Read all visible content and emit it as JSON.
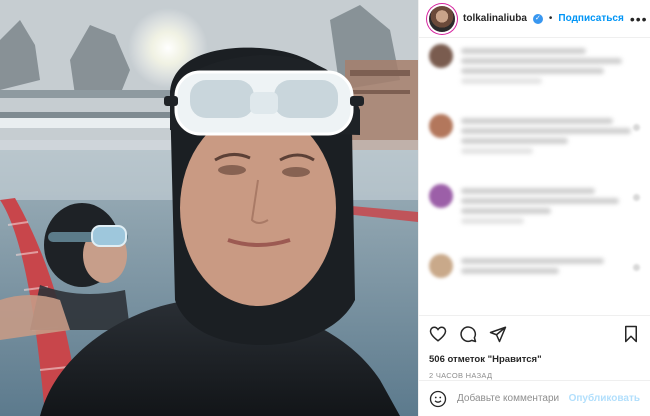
{
  "header": {
    "username": "tolkalinaliuba",
    "verified_glyph": "✓",
    "separator": "•",
    "follow_label": "Подписаться",
    "more_icon": "more-horizontal-icon"
  },
  "comments": [
    {
      "avatar_color": "#7a5c4f"
    },
    {
      "avatar_color": "#b3775c"
    },
    {
      "avatar_color": "#9c5fa8"
    },
    {
      "avatar_color": "#c9a98a"
    }
  ],
  "actions": {
    "like_icon": "heart-icon",
    "comment_icon": "comment-icon",
    "share_icon": "share-icon",
    "save_icon": "bookmark-icon"
  },
  "likes_text": "506 отметок \"Нравится\"",
  "time_text": "2 ЧАСОВ НАЗАД",
  "add_comment": {
    "emoji_icon": "emoji-icon",
    "placeholder": "Добавьте комментарий...",
    "publish_label": "Опубликовать"
  },
  "colors": {
    "accent": "#0095f6",
    "publish_disabled": "#b2dffc",
    "verified": "#3897f0"
  }
}
